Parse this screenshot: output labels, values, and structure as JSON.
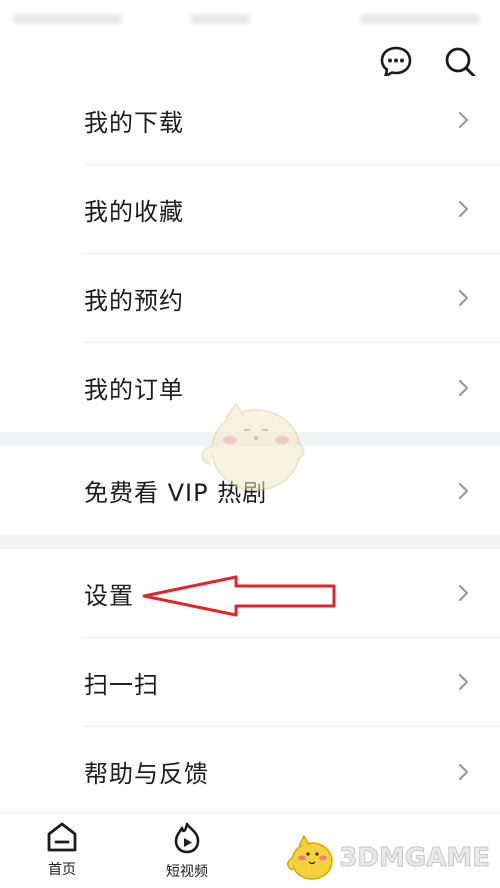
{
  "menu": {
    "group1": [
      {
        "label": "我的下载"
      },
      {
        "label": "我的收藏"
      },
      {
        "label": "我的预约"
      },
      {
        "label": "我的订单"
      }
    ],
    "group2": [
      {
        "label": "免费看 VIP 热剧"
      }
    ],
    "group3": [
      {
        "label": "设置"
      },
      {
        "label": "扫一扫"
      },
      {
        "label": "帮助与反馈"
      }
    ]
  },
  "tabs": [
    {
      "label": "首页",
      "icon": "home-icon"
    },
    {
      "label": "短视频",
      "icon": "short-video-icon"
    }
  ],
  "header": {
    "icons": [
      "message-icon",
      "search-icon"
    ]
  },
  "watermark": {
    "text": "3DMGAME"
  },
  "colors": {
    "annotation": "#e0252b",
    "divider": "#f2f3f5",
    "chevron": "#9a9a9a"
  }
}
